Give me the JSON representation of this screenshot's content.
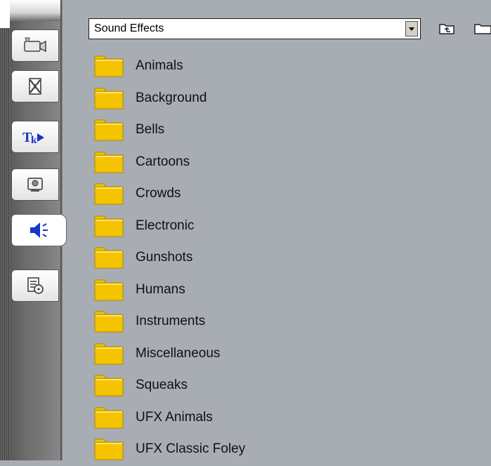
{
  "dropdown": {
    "value": "Sound Effects"
  },
  "toolbar": {
    "up_icon": "folder-up-icon",
    "new_folder_icon": "new-folder-icon"
  },
  "tabs": [
    {
      "icon": "video-camera-icon",
      "active": false
    },
    {
      "icon": "transitions-icon",
      "active": false
    },
    {
      "icon": "titles-icon",
      "active": false
    },
    {
      "icon": "still-image-icon",
      "active": false
    },
    {
      "icon": "sound-effects-icon",
      "active": true
    },
    {
      "icon": "disc-menu-icon",
      "active": false
    }
  ],
  "folders": [
    {
      "label": "Animals"
    },
    {
      "label": "Background"
    },
    {
      "label": "Bells"
    },
    {
      "label": "Cartoons"
    },
    {
      "label": "Crowds"
    },
    {
      "label": "Electronic"
    },
    {
      "label": "Gunshots"
    },
    {
      "label": "Humans"
    },
    {
      "label": "Instruments"
    },
    {
      "label": "Miscellaneous"
    },
    {
      "label": "Squeaks"
    },
    {
      "label": "UFX Animals"
    },
    {
      "label": "UFX Classic Foley"
    }
  ],
  "colors": {
    "folder_fill": "#f5c400",
    "folder_border": "#b08a00",
    "panel_bg": "#a8acb3"
  }
}
